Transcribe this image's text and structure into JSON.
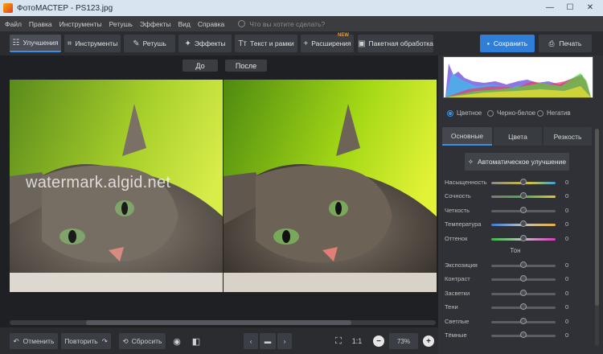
{
  "window": {
    "title": "ФотоМАСТЕР - PS123.jpg",
    "controls": {
      "minimize": "—",
      "maximize": "☐",
      "close": "✕"
    }
  },
  "menu": {
    "items": [
      "Файл",
      "Правка",
      "Инструменты",
      "Ретушь",
      "Эффекты",
      "Вид",
      "Справка"
    ],
    "search_placeholder": "Что вы хотите сделать?"
  },
  "toolbar": {
    "tabs": [
      {
        "label": "Улучшения",
        "icon": "sliders-icon"
      },
      {
        "label": "Инструменты",
        "icon": "crop-icon"
      },
      {
        "label": "Ретушь",
        "icon": "brush-icon"
      },
      {
        "label": "Эффекты",
        "icon": "magic-wand-icon"
      },
      {
        "label": "Текст и рамки",
        "icon": "text-icon"
      },
      {
        "label": "Расширения",
        "icon": "plus-icon",
        "badge": "NEW"
      },
      {
        "label": "Пакетная обработка",
        "icon": "batch-icon"
      }
    ],
    "save_label": "Сохранить",
    "print_label": "Печать"
  },
  "canvas": {
    "before_label": "До",
    "after_label": "После",
    "watermark": "watermark.algid.net"
  },
  "bottombar": {
    "undo_label": "Отменить",
    "redo_label": "Повторить",
    "reset_label": "Сбросить",
    "zoom_1to1": "1:1",
    "zoom_value": "73%"
  },
  "panel": {
    "modes": [
      "Цветное",
      "Черно-белое",
      "Негатив"
    ],
    "selected_mode": "Цветное",
    "tabs": [
      "Основные",
      "Цвета",
      "Резкость"
    ],
    "auto_button": "Автоматическое улучшение",
    "sliders_main": [
      {
        "label": "Насыщенность",
        "value": "0"
      },
      {
        "label": "Сочность",
        "value": "0"
      },
      {
        "label": "Четкость",
        "value": "0"
      },
      {
        "label": "Температура",
        "value": "0"
      },
      {
        "label": "Оттенок",
        "value": "0"
      }
    ],
    "section_tone": "Тон",
    "sliders_tone": [
      {
        "label": "Экспозиция",
        "value": "0"
      },
      {
        "label": "Контраст",
        "value": "0"
      },
      {
        "label": "Засветки",
        "value": "0"
      },
      {
        "label": "Тени",
        "value": "0"
      },
      {
        "label": "Светлые",
        "value": "0"
      },
      {
        "label": "Тёмные",
        "value": "0"
      }
    ]
  },
  "colors": {
    "accent": "#2f7fd8",
    "badge_new": "#f39a28"
  }
}
